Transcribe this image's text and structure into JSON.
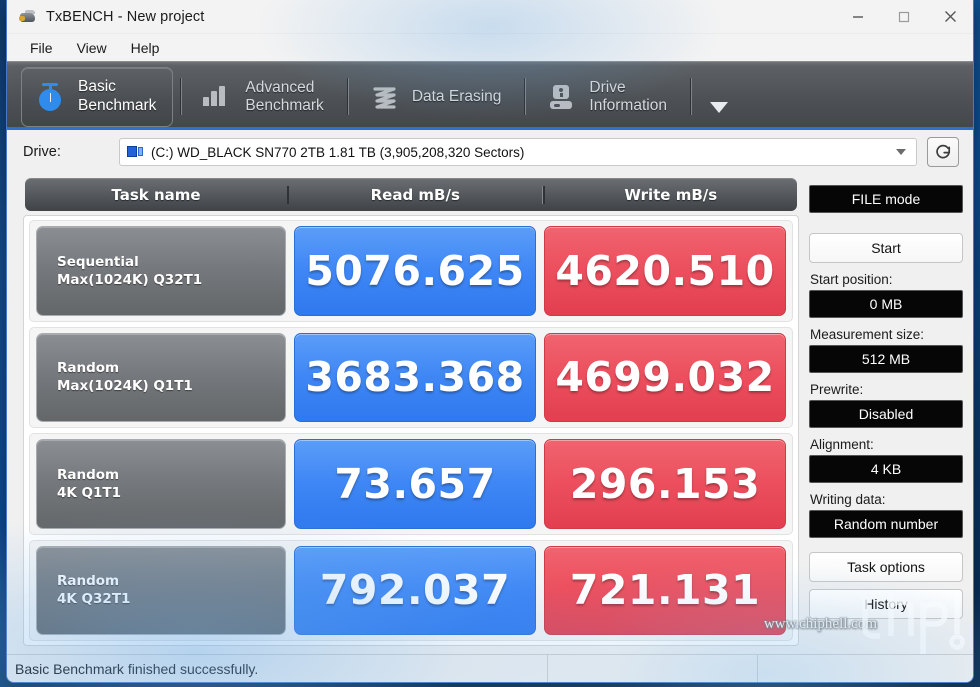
{
  "window": {
    "title": "TxBENCH - New project",
    "icon": "app-icon",
    "minimize_label": "Minimize",
    "maximize_label": "Maximize",
    "close_label": "Close"
  },
  "menu": {
    "items": [
      {
        "label": "File"
      },
      {
        "label": "View"
      },
      {
        "label": "Help"
      }
    ]
  },
  "tabs": {
    "items": [
      {
        "label": "Basic\nBenchmark",
        "icon": "stopwatch-icon",
        "active": true
      },
      {
        "label": "Advanced\nBenchmark",
        "icon": "bar-chart-icon",
        "active": false
      },
      {
        "label": "Data Erasing",
        "icon": "shredder-icon",
        "active": false
      },
      {
        "label": "Drive\nInformation",
        "icon": "drive-info-icon",
        "active": false
      }
    ],
    "overflow_label": "More tabs"
  },
  "drive": {
    "label": "Drive:",
    "selected": "(C:) WD_BLACK SN770 2TB  1.81 TB (3,905,208,320 Sectors)",
    "icon": "disk-drive-icon",
    "refresh_icon": "refresh-icon"
  },
  "results": {
    "headers": {
      "task": "Task name",
      "read": "Read mB/s",
      "write": "Write mB/s"
    },
    "rows": [
      {
        "name_line1": "Sequential",
        "name_line2": "Max(1024K) Q32T1",
        "read": "5076.625",
        "write": "4620.510"
      },
      {
        "name_line1": "Random",
        "name_line2": "Max(1024K) Q1T1",
        "read": "3683.368",
        "write": "4699.032"
      },
      {
        "name_line1": "Random",
        "name_line2": "4K Q1T1",
        "read": "73.657",
        "write": "296.153"
      },
      {
        "name_line1": "Random",
        "name_line2": "4K Q32T1",
        "read": "792.037",
        "write": "721.131"
      }
    ]
  },
  "sidepanel": {
    "mode_value": "FILE mode",
    "start_button": "Start",
    "start_position_label": "Start position:",
    "start_position_value": "0 MB",
    "measurement_size_label": "Measurement size:",
    "measurement_size_value": "512 MB",
    "prewrite_label": "Prewrite:",
    "prewrite_value": "Disabled",
    "alignment_label": "Alignment:",
    "alignment_value": "4 KB",
    "writing_data_label": "Writing data:",
    "writing_data_value": "Random number",
    "task_options_button": "Task options",
    "history_button": "History"
  },
  "status": {
    "message": "Basic Benchmark finished successfully.",
    "cell2": "",
    "cell3": ""
  },
  "watermark": {
    "text": "www.chiphell.com",
    "logo": "chiphell-logo"
  },
  "colors": {
    "read_blue": "#3f87f5",
    "write_red": "#ec4f5e",
    "tab_accent": "#2f6fd0",
    "task_gray": "#76797d"
  }
}
